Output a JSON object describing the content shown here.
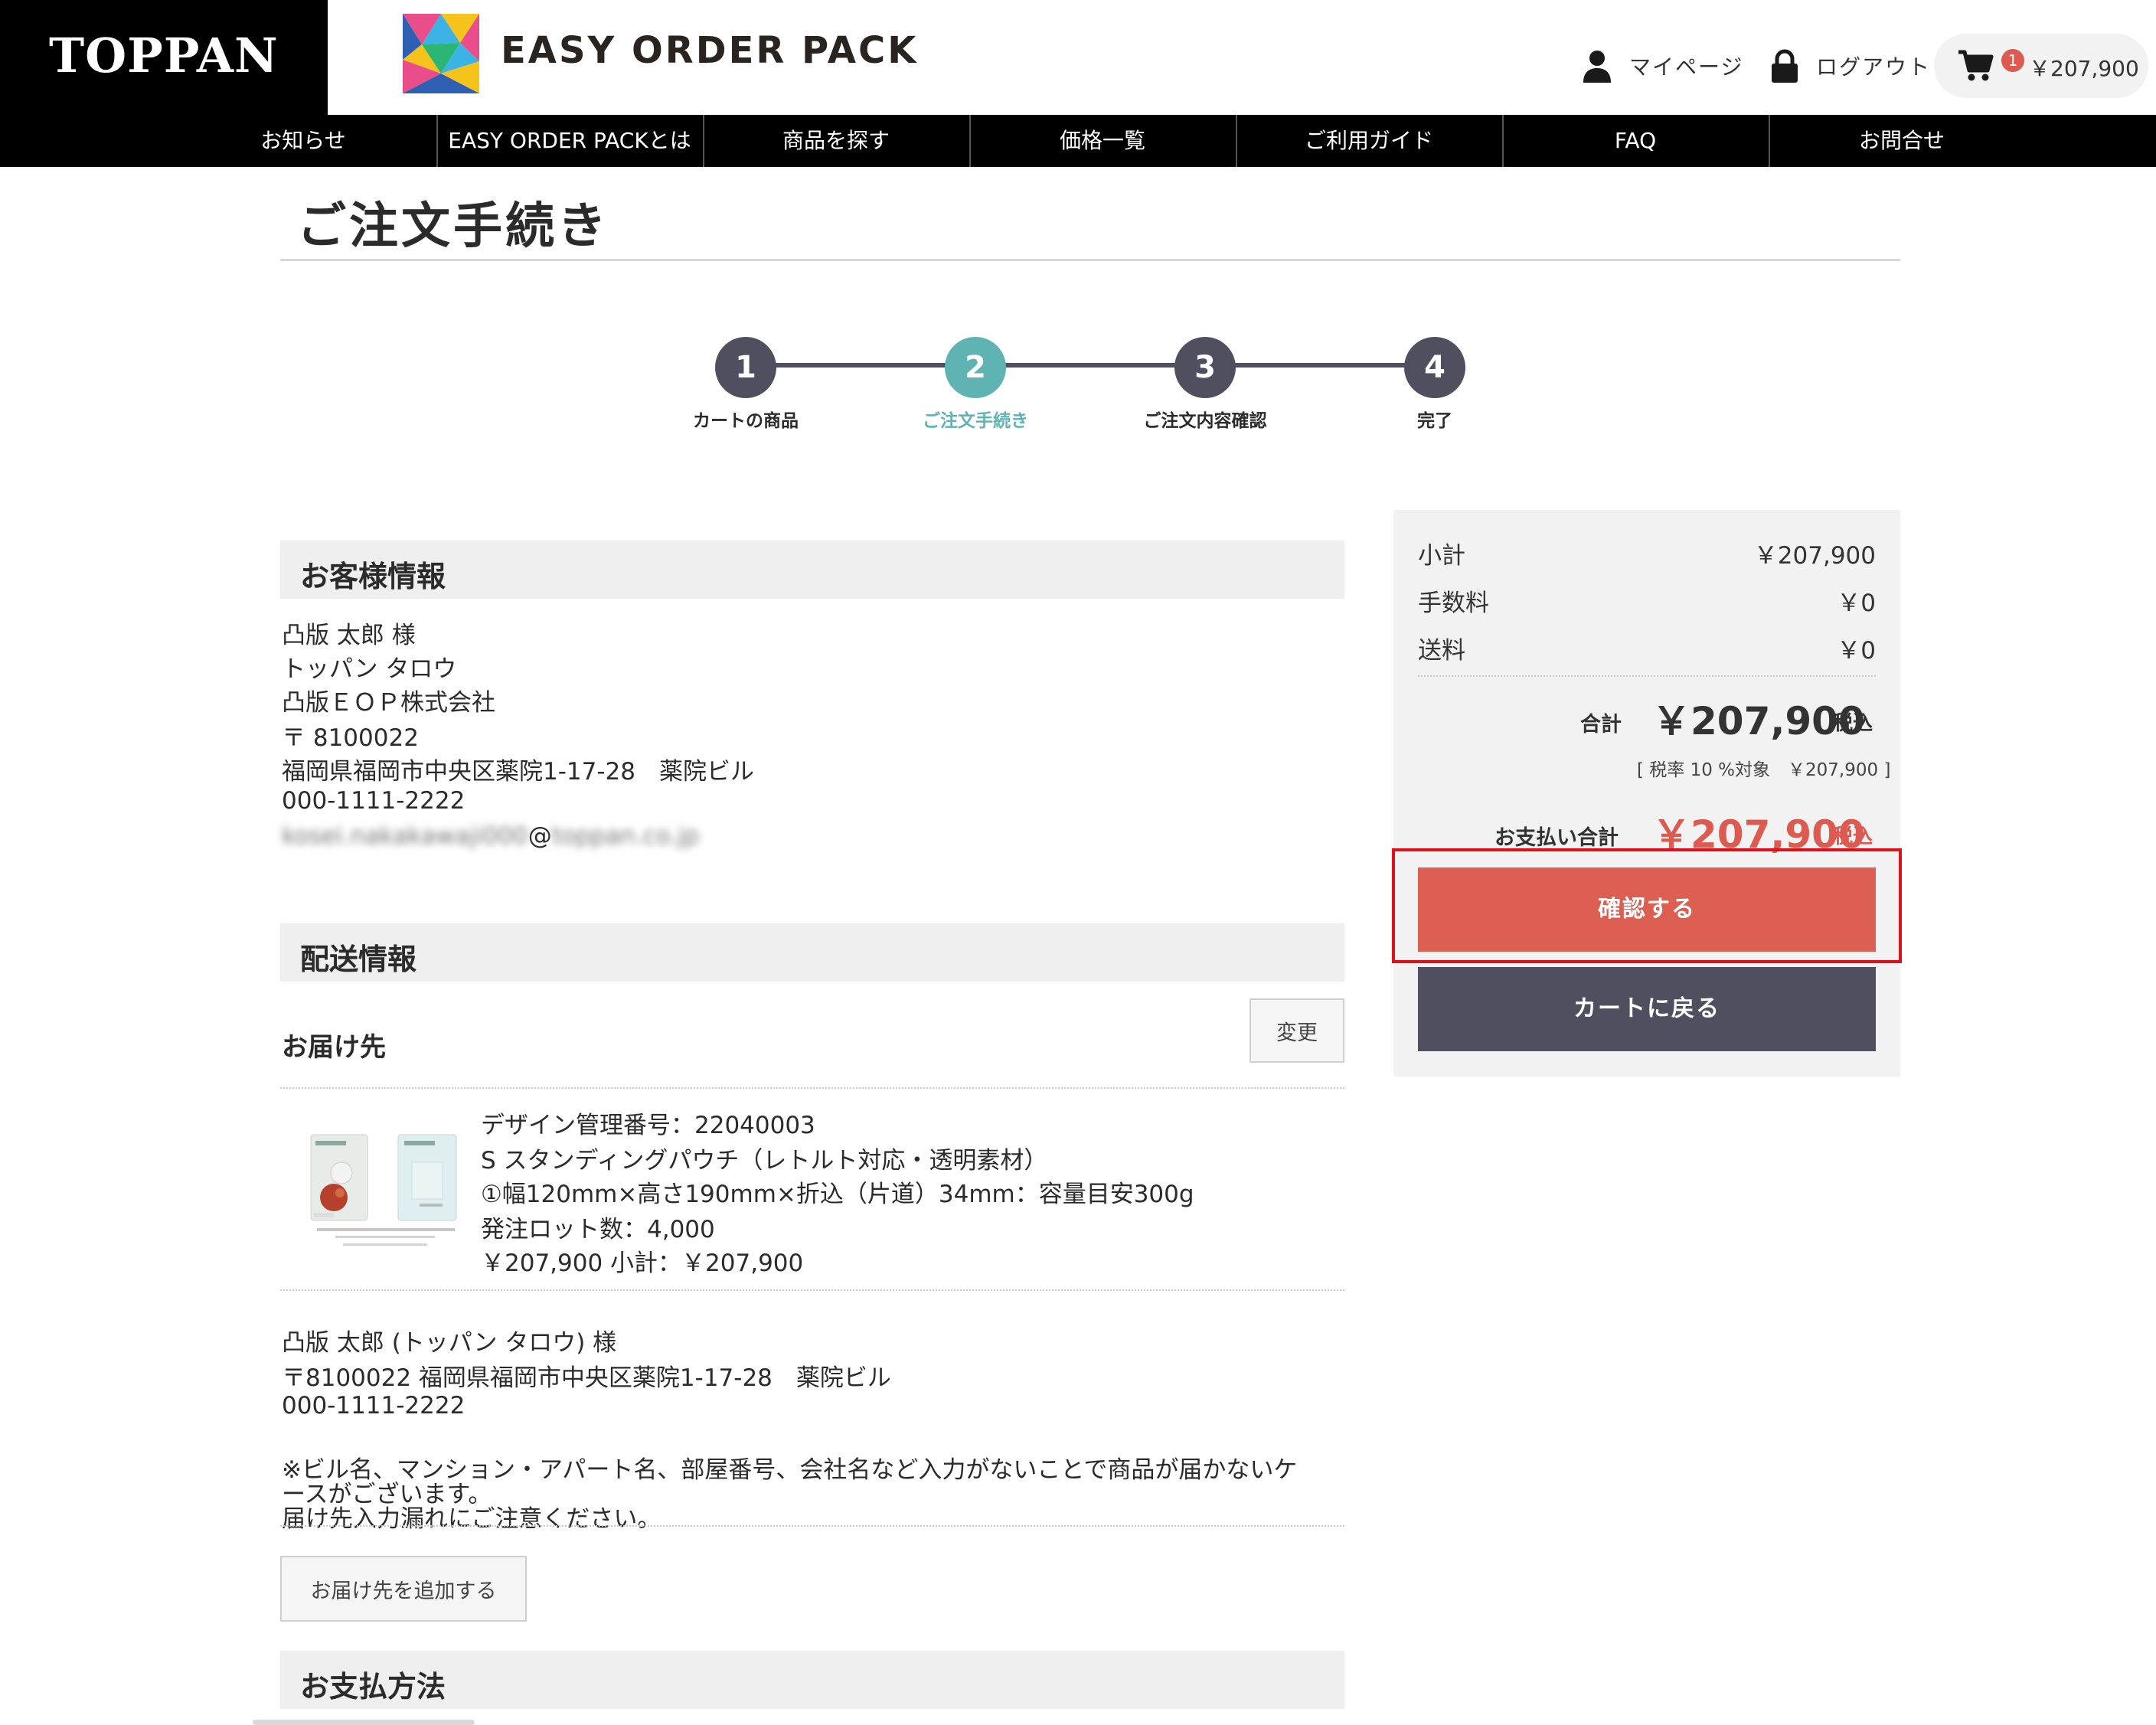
{
  "header": {
    "brand": "TOPPAN",
    "product_name": "EASY ORDER PACK",
    "mypage_label": "マイページ",
    "logout_label": "ログアウト",
    "cart_count": "1",
    "cart_amount": "￥207,900"
  },
  "nav": [
    {
      "label": "お知らせ"
    },
    {
      "label": "EASY ORDER PACKとは"
    },
    {
      "label": "商品を探す"
    },
    {
      "label": "価格一覧"
    },
    {
      "label": "ご利用ガイド"
    },
    {
      "label": "FAQ"
    },
    {
      "label": "お問合せ"
    }
  ],
  "page_title": "ご注文手続き",
  "steps": [
    {
      "number": "1",
      "label": "カートの商品"
    },
    {
      "number": "2",
      "label": "ご注文手続き"
    },
    {
      "number": "3",
      "label": "ご注文内容確認"
    },
    {
      "number": "4",
      "label": "完了"
    }
  ],
  "customer": {
    "heading": "お客様情報",
    "name": "凸版 太郎 様",
    "kana": "トッパン タロウ",
    "company": "凸版ＥＯＰ株式会社",
    "postal": "〒 8100022",
    "address": "福岡県福岡市中央区薬院1-17-28　薬院ビル",
    "phone": "000-1111-2222",
    "email_user": "kosei.nakakawaji000",
    "email_at": "@",
    "email_domain": "toppan.co.jp"
  },
  "delivery": {
    "heading": "配送情報",
    "destination_label": "お届け先",
    "change_button": "変更",
    "item": {
      "design_no": "デザイン管理番号：22040003",
      "name": "S スタンディングパウチ（レトルト対応・透明素材）",
      "size": "①幅120mm×高さ190mm×折込（片道）34mm：容量目安300g",
      "lot": "発注ロット数：4,000",
      "price": "￥207,900 小計：￥207,900"
    },
    "recipient_name": "凸版 太郎 (トッパン タロウ) 様",
    "recipient_address": "〒8100022 福岡県福岡市中央区薬院1-17-28　薬院ビル",
    "recipient_phone": "000-1111-2222",
    "notice_line1": "※ビル名、マンション・アパート名、部屋番号、会社名など入力がないことで商品が届かないケ",
    "notice_line2": "ースがございます。",
    "notice_line3": "届け先入力漏れにご注意ください。",
    "add_destination_button": "お届け先を追加する"
  },
  "payment": {
    "heading": "お支払方法"
  },
  "summary": {
    "subtotal_label": "小計",
    "subtotal_value": "￥207,900",
    "fee_label": "手数料",
    "fee_value": "￥0",
    "shipping_label": "送料",
    "shipping_value": "￥0",
    "total_label": "合計",
    "total_value": "￥207,900",
    "tax_incl": "税込",
    "tax_note": "[ 税率 10 %対象　￥207,900 ]",
    "payment_total_label": "お支払い合計",
    "payment_total_value": "￥207,900",
    "payment_tax_incl": "税込",
    "confirm_button": "確認する",
    "back_button": "カートに戻る"
  },
  "colors": {
    "accent_red": "#dc5f52",
    "step_active": "#5fb3b3",
    "step_default": "#4f4f5f",
    "highlight": "#e0101a"
  }
}
